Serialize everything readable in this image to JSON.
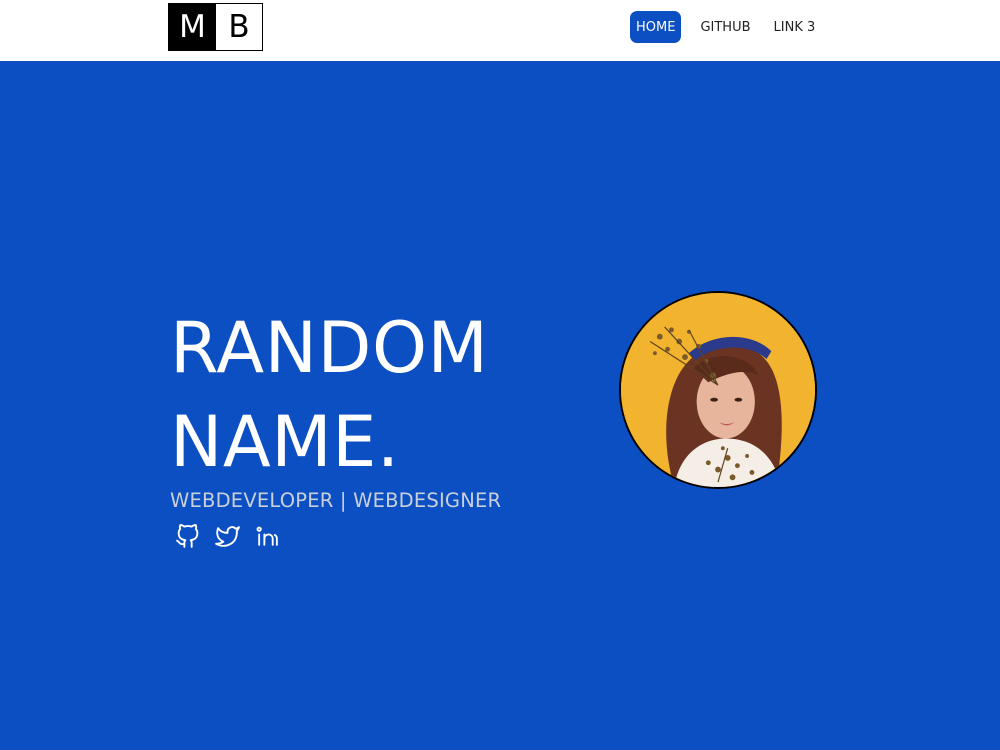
{
  "navbar": {
    "logo": {
      "left": "M",
      "right": "B"
    },
    "links": [
      {
        "label": "HOME",
        "active": true
      },
      {
        "label": "GITHUB",
        "active": false
      },
      {
        "label": "LINK 3",
        "active": false
      }
    ]
  },
  "hero": {
    "title_line1": "RANDOM",
    "title_line2": "NAME.",
    "subtitle": "WEBDEVELOPER | WEBDESIGNER",
    "social_icons": [
      "github-icon",
      "twitter-icon",
      "linkedin-icon"
    ],
    "avatar": "profile-photo"
  },
  "colors": {
    "primary_blue": "#0c4fc2",
    "navbar_bg": "#ffffff",
    "subtitle_gray": "#c9d0db",
    "avatar_bg_yellow": "#f2b32e"
  }
}
